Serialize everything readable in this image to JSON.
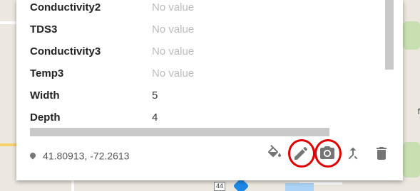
{
  "map": {
    "route_shield": "44",
    "edge_text": "f"
  },
  "popup": {
    "fields": [
      {
        "label": "Conductivity2",
        "value": "No value"
      },
      {
        "label": "TDS3",
        "value": "No value"
      },
      {
        "label": "Conductivity3",
        "value": "No value"
      },
      {
        "label": "Temp3",
        "value": "No value"
      },
      {
        "label": "Width",
        "value": "5"
      },
      {
        "label": "Depth",
        "value": "4"
      }
    ],
    "coordinates": "41.80913, -72.2613",
    "actions": [
      "fill-icon",
      "pencil-icon",
      "camera-icon",
      "filter-icon",
      "trash-icon"
    ],
    "highlight_color": "#e00000"
  }
}
